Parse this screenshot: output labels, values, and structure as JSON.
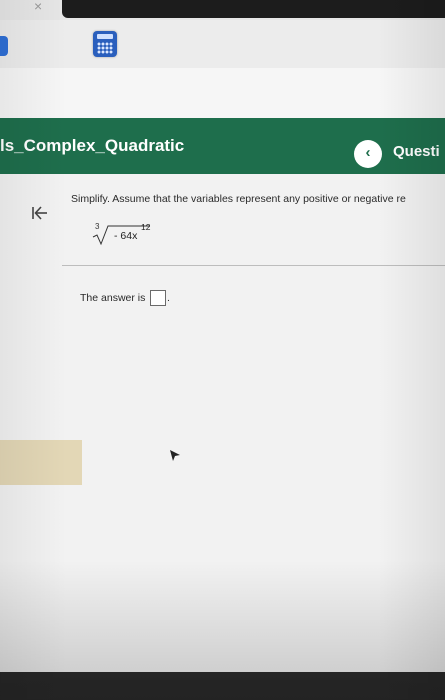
{
  "window": {
    "close_glyph": "×"
  },
  "toolbar": {
    "calculator_icon": "calculator-icon"
  },
  "header": {
    "title": "ls_Complex_Quadratic",
    "back_glyph": "‹",
    "question_label": "Questi",
    "bg_color": "#1e6e4c"
  },
  "question": {
    "instruction": "Simplify. Assume that the variables represent any positive or negative re",
    "radical_index": "3",
    "radicand": "- 64x",
    "exponent": "12",
    "answer_prefix": "The answer is",
    "answer_value": "",
    "answer_suffix": "."
  },
  "icons": {
    "collapse": "collapse-left-icon",
    "cursor": "cursor-arrow-icon"
  }
}
